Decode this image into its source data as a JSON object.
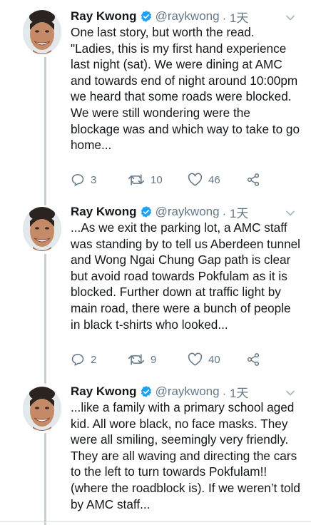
{
  "tweets": [
    {
      "name": "Ray Kwong",
      "handle": "@raykwong",
      "time": "· 1天",
      "text": "One last story, but worth the read. \"Ladies, this is my first hand experience last night (sat). We were dining at AMC and towards end of night around 10:00pm we heard that some roads were blocked. We were still wondering were the blockage was and which way to take to go home...",
      "replies": "3",
      "retweets": "10",
      "likes": "46"
    },
    {
      "name": "Ray Kwong",
      "handle": "@raykwong",
      "time": "· 1天",
      "text": "...As we exit the parking lot, a AMC staff was standing by to tell us Aberdeen tunnel and Wong Ngai Chung Gap path is clear but avoid road towards Pokfulam as it is blocked. Further down at traffic light by main road, there were a bunch of people in black t-shirts who looked...",
      "replies": "2",
      "retweets": "9",
      "likes": "40"
    },
    {
      "name": "Ray Kwong",
      "handle": "@raykwong",
      "time": "· 1天",
      "text": "...like a family with a primary school aged kid. All wore black, no face masks. They were all smiling, seemingly very friendly. They are all waving and directing the cars to the left to turn towards Pokfulam!! (where the roadblock is). If we weren’t told by AMC staff...",
      "replies": "",
      "retweets": "",
      "likes": ""
    }
  ],
  "colors": {
    "text": "#14171a",
    "secondary": "#657786",
    "verified": "#1da1f2",
    "thread_line": "#c4cfd6"
  },
  "icons": [
    "verified-badge-icon",
    "chevron-down-icon",
    "reply-icon",
    "retweet-icon",
    "like-icon",
    "share-icon"
  ]
}
